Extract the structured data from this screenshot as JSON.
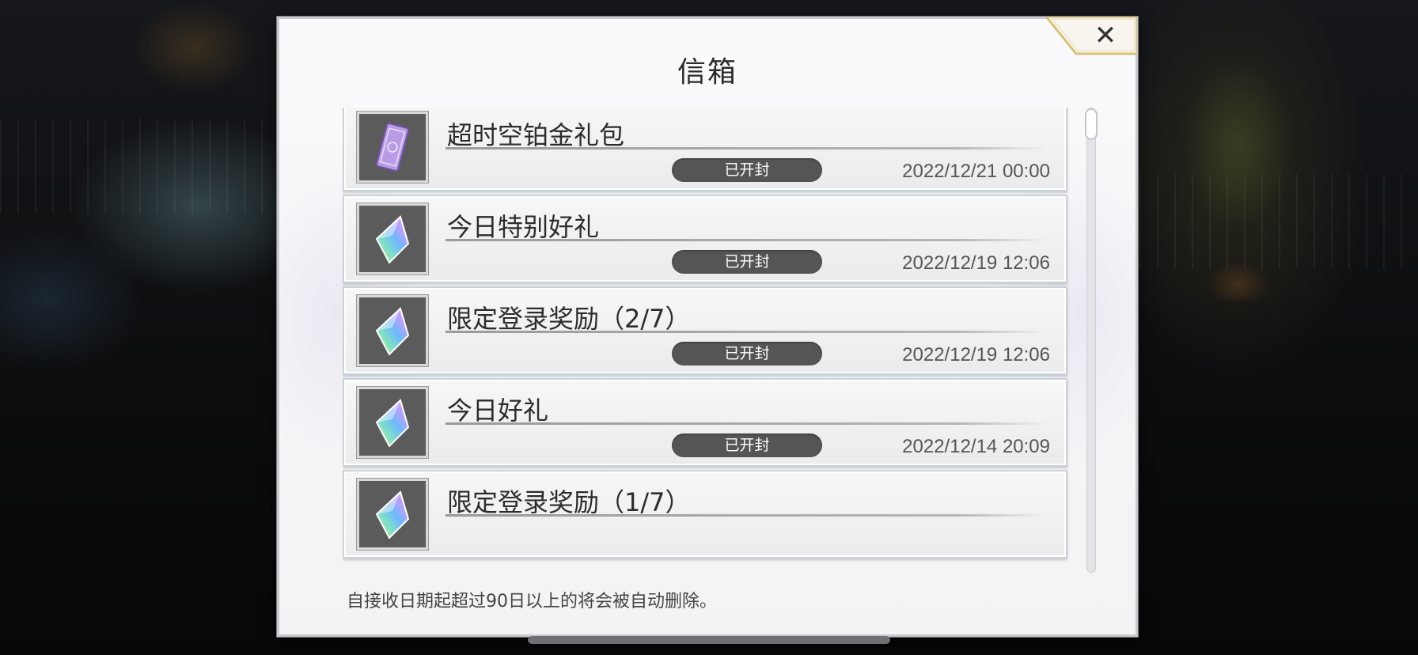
{
  "dialog": {
    "title": "信箱",
    "close_icon": "close-icon",
    "notice": "自接收日期起超过90日以上的将会被自动删除。"
  },
  "mail": {
    "items": [
      {
        "title": "超时空铂金礼包",
        "status": "已开封",
        "date": "2022/12/21 00:00",
        "icon": "ticket-icon",
        "icon_color": "#b99be6"
      },
      {
        "title": "今日特别好礼",
        "status": "已开封",
        "date": "2022/12/19 12:06",
        "icon": "crystal-icon",
        "icon_color": "#7fd3c9"
      },
      {
        "title": "限定登录奖励（2/7）",
        "status": "已开封",
        "date": "2022/12/19 12:06",
        "icon": "crystal-icon",
        "icon_color": "#7fd3c9"
      },
      {
        "title": "今日好礼",
        "status": "已开封",
        "date": "2022/12/14 20:09",
        "icon": "crystal-icon",
        "icon_color": "#7fd3c9"
      },
      {
        "title": "限定登录奖励（1/7）",
        "status": "",
        "date": "",
        "icon": "crystal-icon",
        "icon_color": "#7fd3c9"
      }
    ]
  },
  "colors": {
    "status_pill": "#555555",
    "dialog_bg": "#f6f6f8",
    "accent_gold": "#d8c27a"
  }
}
